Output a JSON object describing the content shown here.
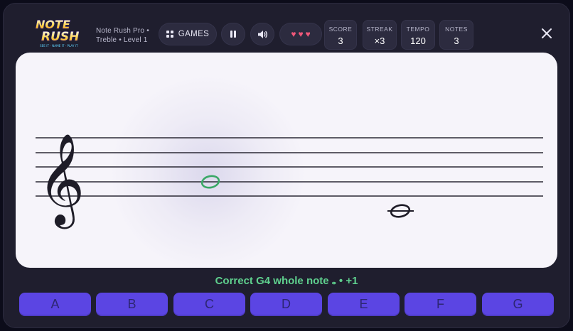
{
  "app": {
    "logo_line1": "NOTE",
    "logo_line2": "RUSH",
    "logo_tagline": "SEE IT · NAME IT · PLAY IT",
    "subtitle_game": "Note Rush Pro",
    "subtitle_clef": "Treble",
    "subtitle_level": "Level 1"
  },
  "toolbar": {
    "games_label": "GAMES",
    "grid_icon": "grid-icon",
    "pause_icon": "pause-icon",
    "sound_icon": "speaker-icon",
    "close_icon": "close-icon",
    "lives": [
      "♥",
      "♥",
      "♥"
    ]
  },
  "stats": [
    {
      "label": "SCORE",
      "value": "3"
    },
    {
      "label": "STREAK",
      "value": "×3"
    },
    {
      "label": "TEMPO",
      "value": "120"
    },
    {
      "label": "NOTES",
      "value": "3"
    }
  ],
  "staff": {
    "clef_glyph": "𝄞",
    "clef": "treble",
    "answered_note": {
      "pitch": "G4",
      "duration": "whole",
      "state": "correct"
    },
    "current_note": {
      "pitch": "B3",
      "duration": "whole",
      "ledger_lines": 1
    }
  },
  "feedback": {
    "text": "Correct G4 whole note 𝅝  •  +1",
    "color": "#5fd08e"
  },
  "answer_keys": [
    "A",
    "B",
    "C",
    "D",
    "E",
    "F",
    "G"
  ],
  "colors": {
    "accent": "#5b45e3",
    "correct": "#5fd08e",
    "heart": "#f0587a",
    "background": "#1f1e2e"
  }
}
